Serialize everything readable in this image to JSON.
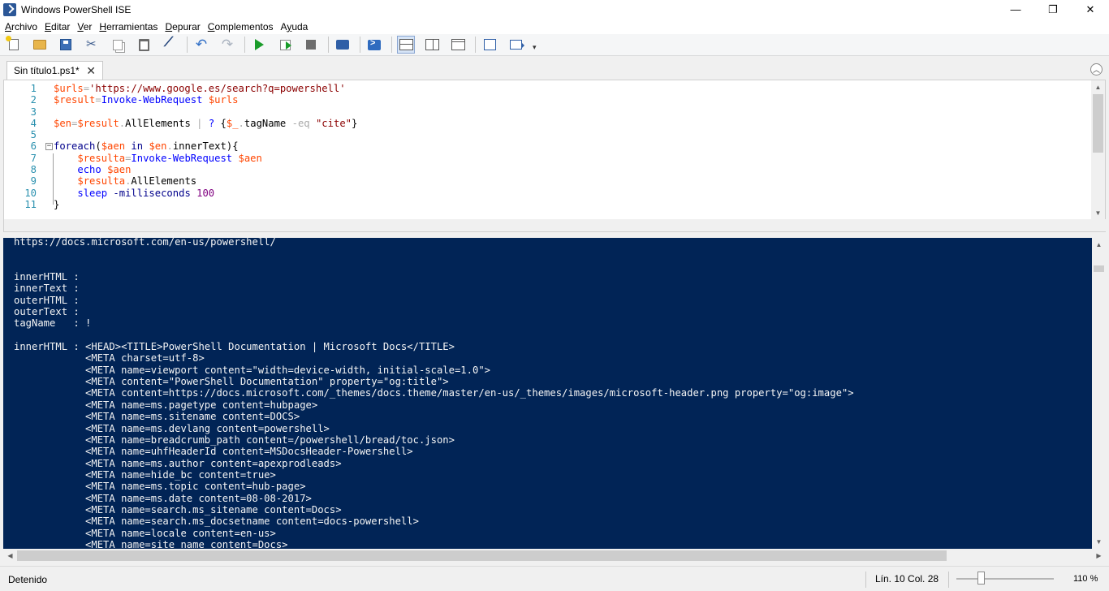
{
  "window": {
    "title": "Windows PowerShell ISE",
    "controls": {
      "minimize": "—",
      "restore": "❐",
      "close": "✕"
    }
  },
  "menu": [
    {
      "label": "Archivo",
      "accel": "A",
      "rest": "rchivo"
    },
    {
      "label": "Editar",
      "accel": "E",
      "rest": "ditar"
    },
    {
      "label": "Ver",
      "accel": "V",
      "rest": "er"
    },
    {
      "label": "Herramientas",
      "accel": "H",
      "rest": "erramientas"
    },
    {
      "label": "Depurar",
      "accel": "D",
      "rest": "epurar"
    },
    {
      "label": "Complementos",
      "accel": "C",
      "rest": "omplementos"
    },
    {
      "label": "Ayuda",
      "accel": "y",
      "pre": "A",
      "rest": "uda"
    }
  ],
  "toolbar": {
    "undo_glyph": "↶",
    "redo_glyph": "↷",
    "overflow_glyph": "▾"
  },
  "tab": {
    "label": "Sin título1.ps1*",
    "close_glyph": "✕"
  },
  "collapse_glyph": "︿",
  "script": {
    "lines": [
      {
        "n": "1",
        "tokens": [
          [
            "var",
            "$urls"
          ],
          [
            "op",
            "="
          ],
          [
            "str",
            "'https://www.google.es/search?q=powershell'"
          ]
        ]
      },
      {
        "n": "2",
        "tokens": [
          [
            "var",
            "$result"
          ],
          [
            "op",
            "="
          ],
          [
            "cmd",
            "Invoke-WebRequest"
          ],
          [
            "plain",
            " "
          ],
          [
            "var",
            "$urls"
          ]
        ]
      },
      {
        "n": "3",
        "tokens": []
      },
      {
        "n": "4",
        "tokens": [
          [
            "var",
            "$en"
          ],
          [
            "op",
            "="
          ],
          [
            "var",
            "$result"
          ],
          [
            "op",
            "."
          ],
          [
            "mem",
            "AllElements"
          ],
          [
            "plain",
            " "
          ],
          [
            "op",
            "|"
          ],
          [
            "plain",
            " "
          ],
          [
            "cmd",
            "?"
          ],
          [
            "plain",
            " {"
          ],
          [
            "var",
            "$_"
          ],
          [
            "op",
            "."
          ],
          [
            "mem",
            "tagName"
          ],
          [
            "plain",
            " "
          ],
          [
            "op",
            "-eq"
          ],
          [
            "plain",
            " "
          ],
          [
            "str",
            "\"cite\""
          ],
          [
            "plain",
            "}"
          ]
        ]
      },
      {
        "n": "5",
        "tokens": []
      },
      {
        "n": "6",
        "fold": true,
        "tokens": [
          [
            "kw",
            "foreach"
          ],
          [
            "plain",
            "("
          ],
          [
            "var",
            "$aen"
          ],
          [
            "plain",
            " "
          ],
          [
            "kw",
            "in"
          ],
          [
            "plain",
            " "
          ],
          [
            "var",
            "$en"
          ],
          [
            "op",
            "."
          ],
          [
            "mem",
            "innerText"
          ],
          [
            "plain",
            "){"
          ]
        ]
      },
      {
        "n": "7",
        "tokens": [
          [
            "plain",
            "    "
          ],
          [
            "var",
            "$resulta"
          ],
          [
            "op",
            "="
          ],
          [
            "cmd",
            "Invoke-WebRequest"
          ],
          [
            "plain",
            " "
          ],
          [
            "var",
            "$aen"
          ]
        ]
      },
      {
        "n": "8",
        "tokens": [
          [
            "plain",
            "    "
          ],
          [
            "cmd",
            "echo"
          ],
          [
            "plain",
            " "
          ],
          [
            "var",
            "$aen"
          ]
        ]
      },
      {
        "n": "9",
        "tokens": [
          [
            "plain",
            "    "
          ],
          [
            "var",
            "$resulta"
          ],
          [
            "op",
            "."
          ],
          [
            "mem",
            "AllElements"
          ]
        ]
      },
      {
        "n": "10",
        "tokens": [
          [
            "plain",
            "    "
          ],
          [
            "cmd",
            "sleep"
          ],
          [
            "plain",
            " "
          ],
          [
            "kw",
            "-milliseconds"
          ],
          [
            "plain",
            " "
          ],
          [
            "num",
            "100"
          ]
        ]
      },
      {
        "n": "11",
        "tokens": [
          [
            "plain",
            "}"
          ]
        ]
      }
    ]
  },
  "console": {
    "lines": [
      "https://docs.microsoft.com/en-us/powershell/",
      "",
      "",
      "innerHTML :",
      "innerText :",
      "outerHTML :",
      "outerText :",
      "tagName   : !",
      "",
      "innerHTML : <HEAD><TITLE>PowerShell Documentation | Microsoft Docs</TITLE>",
      "            <META charset=utf-8>",
      "            <META name=viewport content=\"width=device-width, initial-scale=1.0\">",
      "            <META content=\"PowerShell Documentation\" property=\"og:title\">",
      "            <META content=https://docs.microsoft.com/_themes/docs.theme/master/en-us/_themes/images/microsoft-header.png property=\"og:image\">",
      "            <META name=ms.pagetype content=hubpage>",
      "            <META name=ms.sitename content=DOCS>",
      "            <META name=ms.devlang content=powershell>",
      "            <META name=breadcrumb_path content=/powershell/bread/toc.json>",
      "            <META name=uhfHeaderId content=MSDocsHeader-Powershell>",
      "            <META name=ms.author content=apexprodleads>",
      "            <META name=hide_bc content=true>",
      "            <META name=ms.topic content=hub-page>",
      "            <META name=ms.date content=08-08-2017>",
      "            <META name=search.ms_sitename content=Docs>",
      "            <META name=search.ms_docsetname content=docs-powershell>",
      "            <META name=locale content=en-us>",
      "            <META name=site_name content=Docs>"
    ]
  },
  "status": {
    "state": "Detenido",
    "position": "Lín. 10  Col. 28",
    "zoom": "110 %",
    "zoom_level": 110
  },
  "colors": {
    "console_bg": "#012456",
    "console_fg": "#f5f5f5",
    "var": "#ff4500",
    "string": "#8b0000",
    "command": "#0000ff",
    "operator": "#a9a9a9",
    "number": "#800080",
    "keyword": "#00008b",
    "line_number": "#2b91af"
  }
}
